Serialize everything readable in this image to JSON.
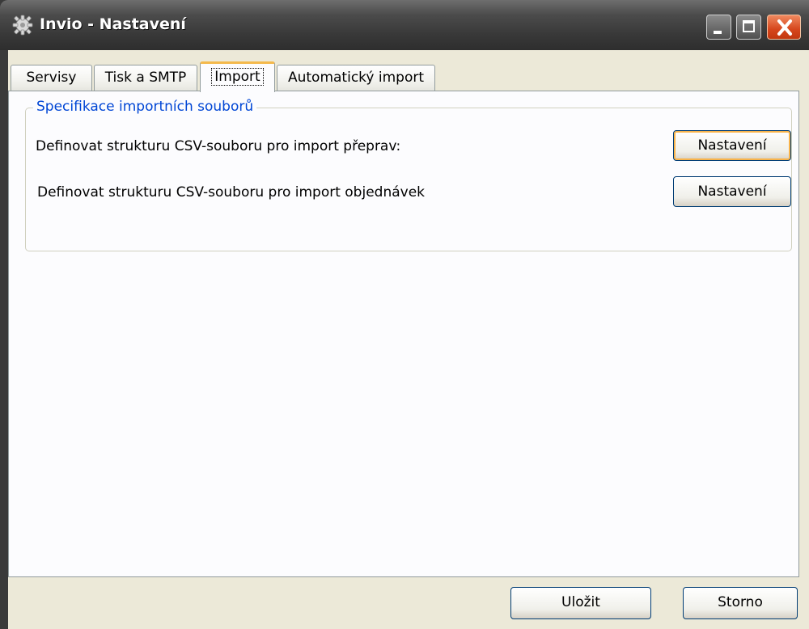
{
  "window": {
    "title": "Invio - Nastavení"
  },
  "tabs": [
    {
      "label": "Servisy",
      "active": false
    },
    {
      "label": "Tisk a SMTP",
      "active": false
    },
    {
      "label": "Import",
      "active": true
    },
    {
      "label": "Automatický import",
      "active": false
    }
  ],
  "import_group": {
    "title": "Specifikace importních souborů",
    "rows": [
      {
        "label": "Definovat strukturu CSV-souboru pro import přeprav:",
        "button": "Nastavení"
      },
      {
        "label": "Definovat strukturu CSV-souboru pro import objednávek",
        "button": "Nastavení"
      }
    ]
  },
  "footer": {
    "save_label": "Uložit",
    "cancel_label": "Storno"
  },
  "colors": {
    "group_title": "#0046d5",
    "active_tab_accent": "#f4b94c",
    "close_button": "#d6461c"
  }
}
